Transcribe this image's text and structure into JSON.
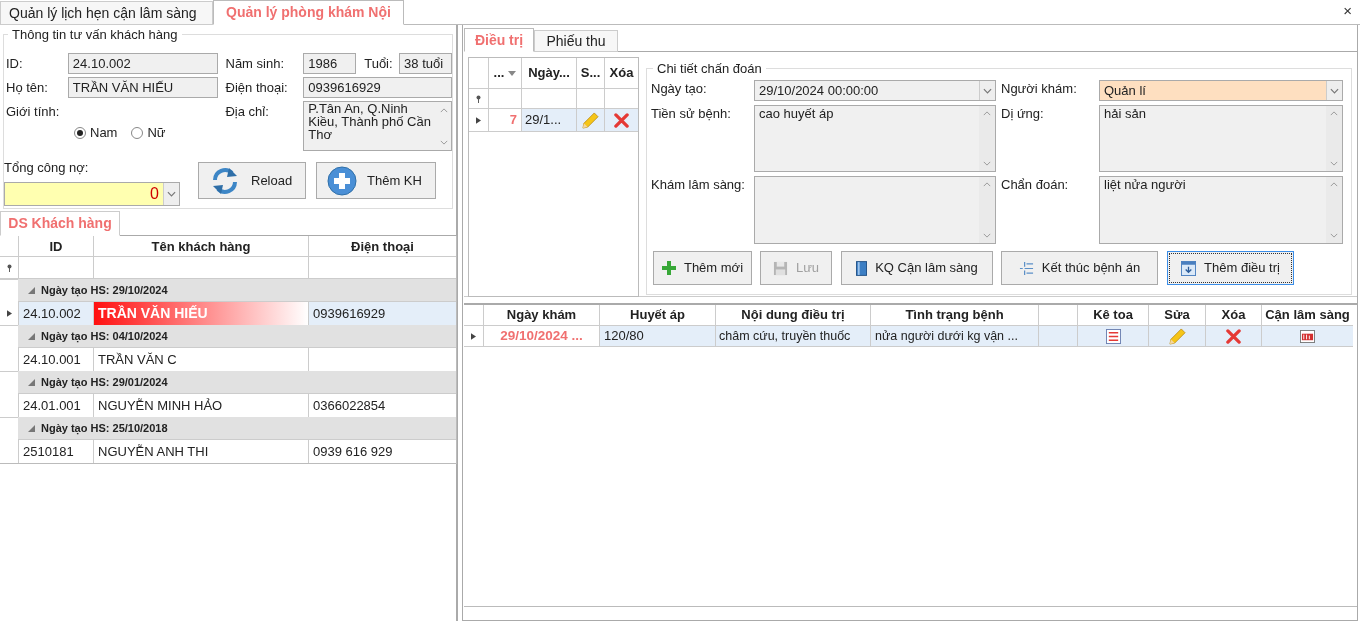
{
  "top_tabs": [
    {
      "label": "Quản lý lịch hẹn cận lâm sàng",
      "selected": false
    },
    {
      "label": "Quản lý phòng khám Nội",
      "selected": true
    }
  ],
  "close_button": "×",
  "customer_info": {
    "title": "Thông tin tư vấn khách hàng",
    "id": {
      "label": "ID:",
      "value": "24.10.002"
    },
    "birth_year": {
      "label": "Năm sinh:",
      "value": "1986"
    },
    "age": {
      "label": "Tuổi:",
      "value": "38 tuổi"
    },
    "full_name": {
      "label": "Họ tên:",
      "value": "TRẦN VĂN HIẾU"
    },
    "phone": {
      "label": "Điện thoại:",
      "value": "0939616929"
    },
    "gender": {
      "label": "Giới tính:",
      "options": [
        {
          "label": "Nam",
          "selected": true
        },
        {
          "label": "Nữ",
          "selected": false
        }
      ]
    },
    "address": {
      "label": "Địa chỉ:",
      "value": "P.Tân An, Q.Ninh Kiều, Thành phố Cần Thơ"
    },
    "total_debt": {
      "label": "Tổng công nợ:",
      "value": "0"
    },
    "buttons": [
      {
        "kind": "reload",
        "label": "Reload"
      },
      {
        "kind": "add",
        "label": "Thêm KH"
      }
    ]
  },
  "customer_list": {
    "tab": "DS Khách hàng",
    "columns": [
      "ID",
      "Tên khách hàng",
      "Điện thoại"
    ],
    "groups": [
      {
        "label": "Ngày tạo HS: 29/10/2024",
        "rows": [
          {
            "id": "24.10.002",
            "name": "TRẦN VĂN HIẾU",
            "phone": "0939616929",
            "selected": true
          }
        ]
      },
      {
        "label": "Ngày tạo HS: 04/10/2024",
        "rows": [
          {
            "id": "24.10.001",
            "name": "TRẦN VĂN C",
            "selected": false
          }
        ]
      },
      {
        "label": "Ngày tạo HS: 29/01/2024",
        "rows": [
          {
            "id": "24.01.001",
            "name": "NGUYỄN MINH HẢO",
            "phone": "0366022854",
            "selected": false
          }
        ]
      },
      {
        "label": "Ngày tạo HS: 25/10/2018",
        "rows": [
          {
            "id": "2510181",
            "name": "NGUYỄN ANH THI",
            "phone": "0939 616 929",
            "selected": false
          }
        ]
      }
    ]
  },
  "treatment": {
    "tabs": [
      {
        "label": "Điều trị",
        "selected": true
      },
      {
        "label": "Phiếu thu",
        "selected": false
      }
    ],
    "visits": {
      "columns": [
        "...",
        "Ngày...",
        "S...",
        "Xóa"
      ],
      "rows": [
        {
          "number": "7",
          "date": "29/1...",
          "selected": true
        }
      ]
    },
    "diagnosis": {
      "title": "Chi tiết chấn đoán",
      "fields": [
        {
          "kind": "combo",
          "label": "Ngày tạo:",
          "value": "29/10/2024 00:00:00",
          "highlighted": false
        },
        {
          "kind": "combo",
          "label": "Người khám:",
          "value": "Quản lí",
          "highlighted": true
        },
        {
          "kind": "memo",
          "label": "Tiền sử bệnh:",
          "value": "cao huyết áp",
          "highlighted": false
        },
        {
          "kind": "memo",
          "label": "Dị ứng:",
          "value": "hải sản",
          "highlighted": false
        },
        {
          "kind": "memo",
          "label": "Khám lâm sàng:",
          "highlighted": false
        },
        {
          "kind": "memo",
          "label": "Chẩn đoán:",
          "value": "liệt nửa người",
          "highlighted": false
        }
      ],
      "buttons": [
        {
          "kind": "add",
          "label": "Thêm mới",
          "disabled": false,
          "focused": false
        },
        {
          "kind": "save",
          "label": "Lưu",
          "disabled": true,
          "focused": false
        },
        {
          "kind": "lab",
          "label": "KQ Cận lâm sàng",
          "disabled": false,
          "focused": false
        },
        {
          "kind": "end",
          "label": "Kết thúc bệnh án",
          "disabled": false,
          "focused": false
        },
        {
          "kind": "add_treatment",
          "label": "Thêm điều trị",
          "disabled": false,
          "focused": true
        }
      ]
    },
    "treatments": {
      "columns": [
        "Ngày khám",
        "Huyết áp",
        "Nội dung điều trị",
        "Tình trạng bệnh",
        "Kê toa",
        "Sửa",
        "Xóa",
        "Cận lâm sàng"
      ],
      "rows": [
        {
          "date": "29/10/2024 ...",
          "blood_pressure": "120/80",
          "content": "châm cứu, truyền thuốc",
          "condition": "nửa người dưới kg vận ...",
          "selected": true
        }
      ]
    }
  }
}
